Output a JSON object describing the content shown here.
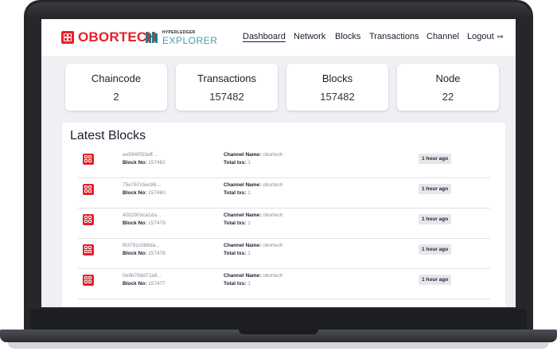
{
  "header": {
    "brand": "OBORTECH",
    "hyperledger_top": "HYPERLEDGER",
    "hyperledger_bottom": "EXPLORER",
    "nav": [
      "Dashboard",
      "Network",
      "Blocks",
      "Transactions",
      "Channel",
      "Logout"
    ],
    "active_nav": "Dashboard",
    "logout_icon": "logout-arrow-icon"
  },
  "stats": [
    {
      "label": "Chaincode",
      "value": "2"
    },
    {
      "label": "Transactions",
      "value": "157482"
    },
    {
      "label": "Blocks",
      "value": "157482"
    },
    {
      "label": "Node",
      "value": "22"
    }
  ],
  "latest_blocks": {
    "title": "Latest Blocks",
    "block_no_label": "Block No:",
    "channel_label": "Channel Name:",
    "total_label": "Total txs:",
    "rows": [
      {
        "hash": "ee594f053eff...",
        "block_no": "157481",
        "channel": "obortech",
        "total_txs": "1",
        "time": "1 hour ago"
      },
      {
        "hash": "75e767c5ec86...",
        "block_no": "157480",
        "channel": "obortech",
        "total_txs": "1",
        "time": "1 hour ago"
      },
      {
        "hash": "42b2903ca1da...",
        "block_no": "157479",
        "channel": "obortech",
        "total_txs": "1",
        "time": "1 hour ago"
      },
      {
        "hash": "f63791c088da...",
        "block_no": "157478",
        "channel": "obortech",
        "total_txs": "1",
        "time": "1 hour ago"
      },
      {
        "hash": "0e9b79dd72a9...",
        "block_no": "157477",
        "channel": "obortech",
        "total_txs": "1",
        "time": "1 hour ago"
      }
    ]
  },
  "colors": {
    "brand_red": "#e3202b",
    "hyperledger_teal": "#3ea0a8",
    "laptop_frame": "#26272b"
  }
}
